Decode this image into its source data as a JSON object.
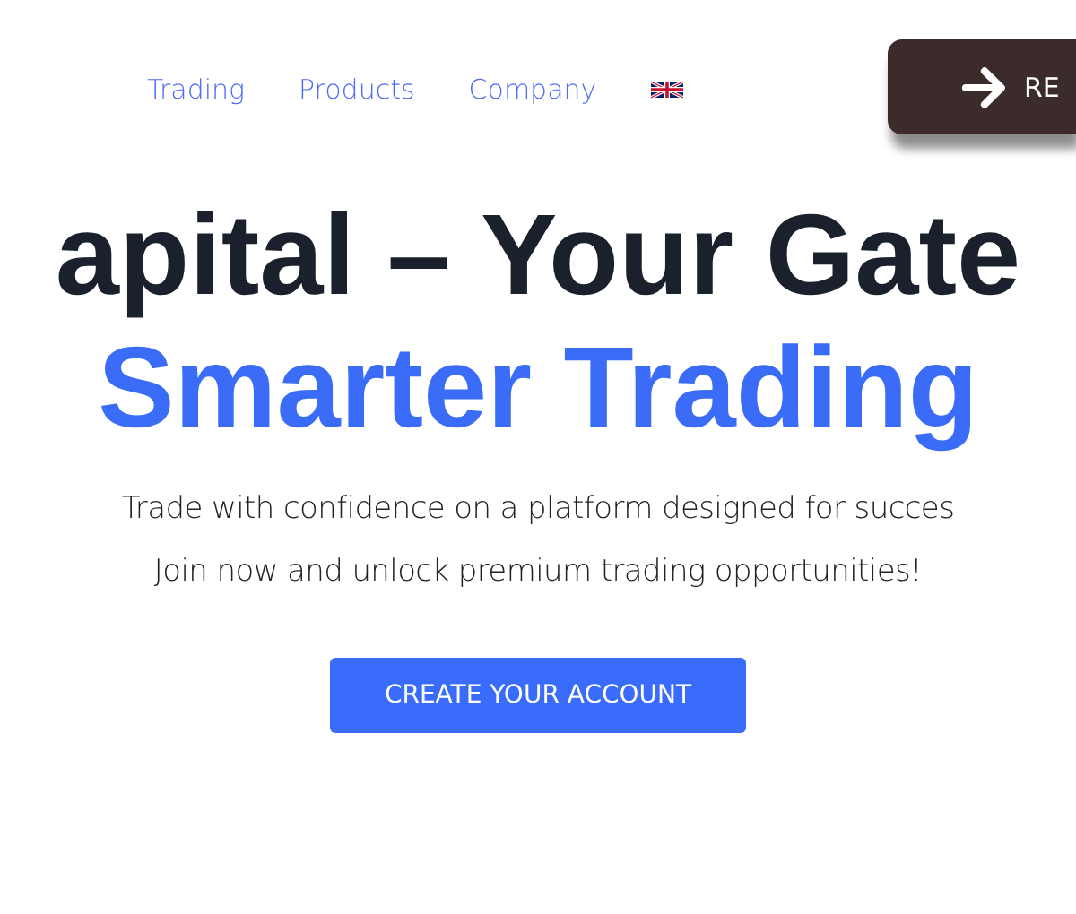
{
  "nav": {
    "links": [
      "Trading",
      "Products",
      "Company"
    ],
    "register_button": "RE"
  },
  "hero": {
    "title_line_1": "apital – Your Gate",
    "title_line_2": "Smarter Trading",
    "subtitle_lines": [
      "Trade with confidence on a platform designed for succes",
      "Join now and unlock premium trading opportunities!"
    ],
    "cta": "CREATE YOUR ACCOUNT"
  }
}
